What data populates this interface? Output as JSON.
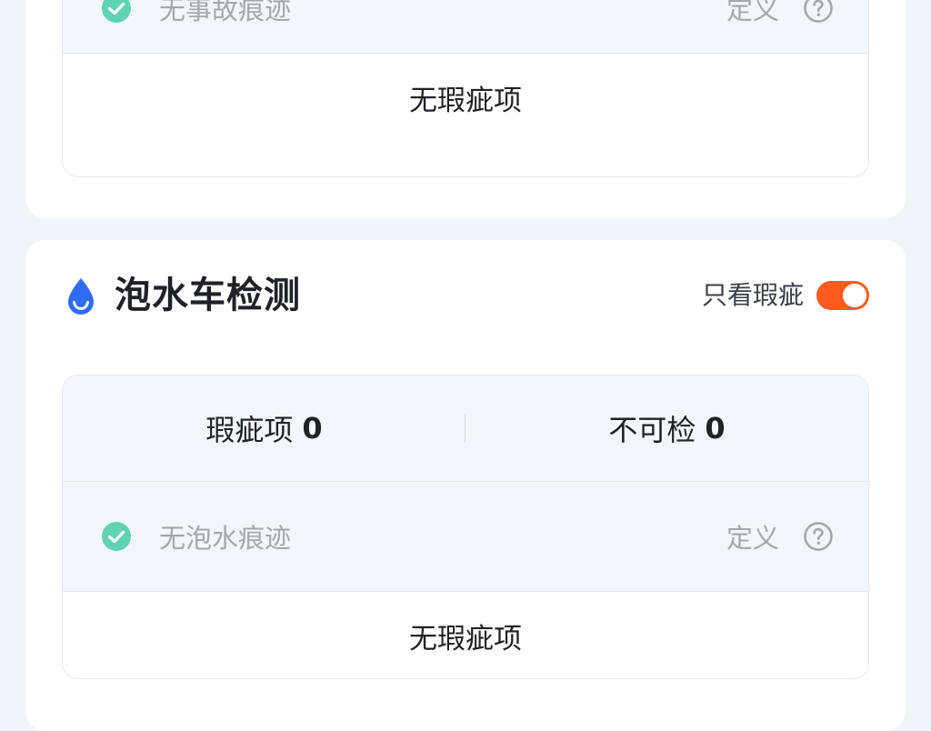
{
  "accident": {
    "item": {
      "label": "无事故痕迹",
      "definition_link": "定义",
      "status_icon": "check-circle-icon",
      "help_icon": "question-circle-icon"
    },
    "summary": "无瑕疵项"
  },
  "flood": {
    "icon": "water-drop-icon",
    "title": "泡水车检测",
    "filter": {
      "label": "只看瑕疵",
      "enabled": true
    },
    "stats": {
      "defects_label": "瑕疵项",
      "defects_count": "0",
      "uncheckable_label": "不可检",
      "uncheckable_count": "0"
    },
    "item": {
      "label": "无泡水痕迹",
      "definition_link": "定义",
      "status_icon": "check-circle-icon",
      "help_icon": "question-circle-icon"
    },
    "summary": "无瑕疵项"
  },
  "colors": {
    "page_bg": "#f3f4f7",
    "card_bg": "#ffffff",
    "row_bg": "#f3f7fb",
    "check_green": "#5fd3b3",
    "toggle_on": "#ff5a1f",
    "drop_blue": "#2f6cf6",
    "muted_text": "#a3a7af",
    "primary_text": "#1f2126"
  }
}
